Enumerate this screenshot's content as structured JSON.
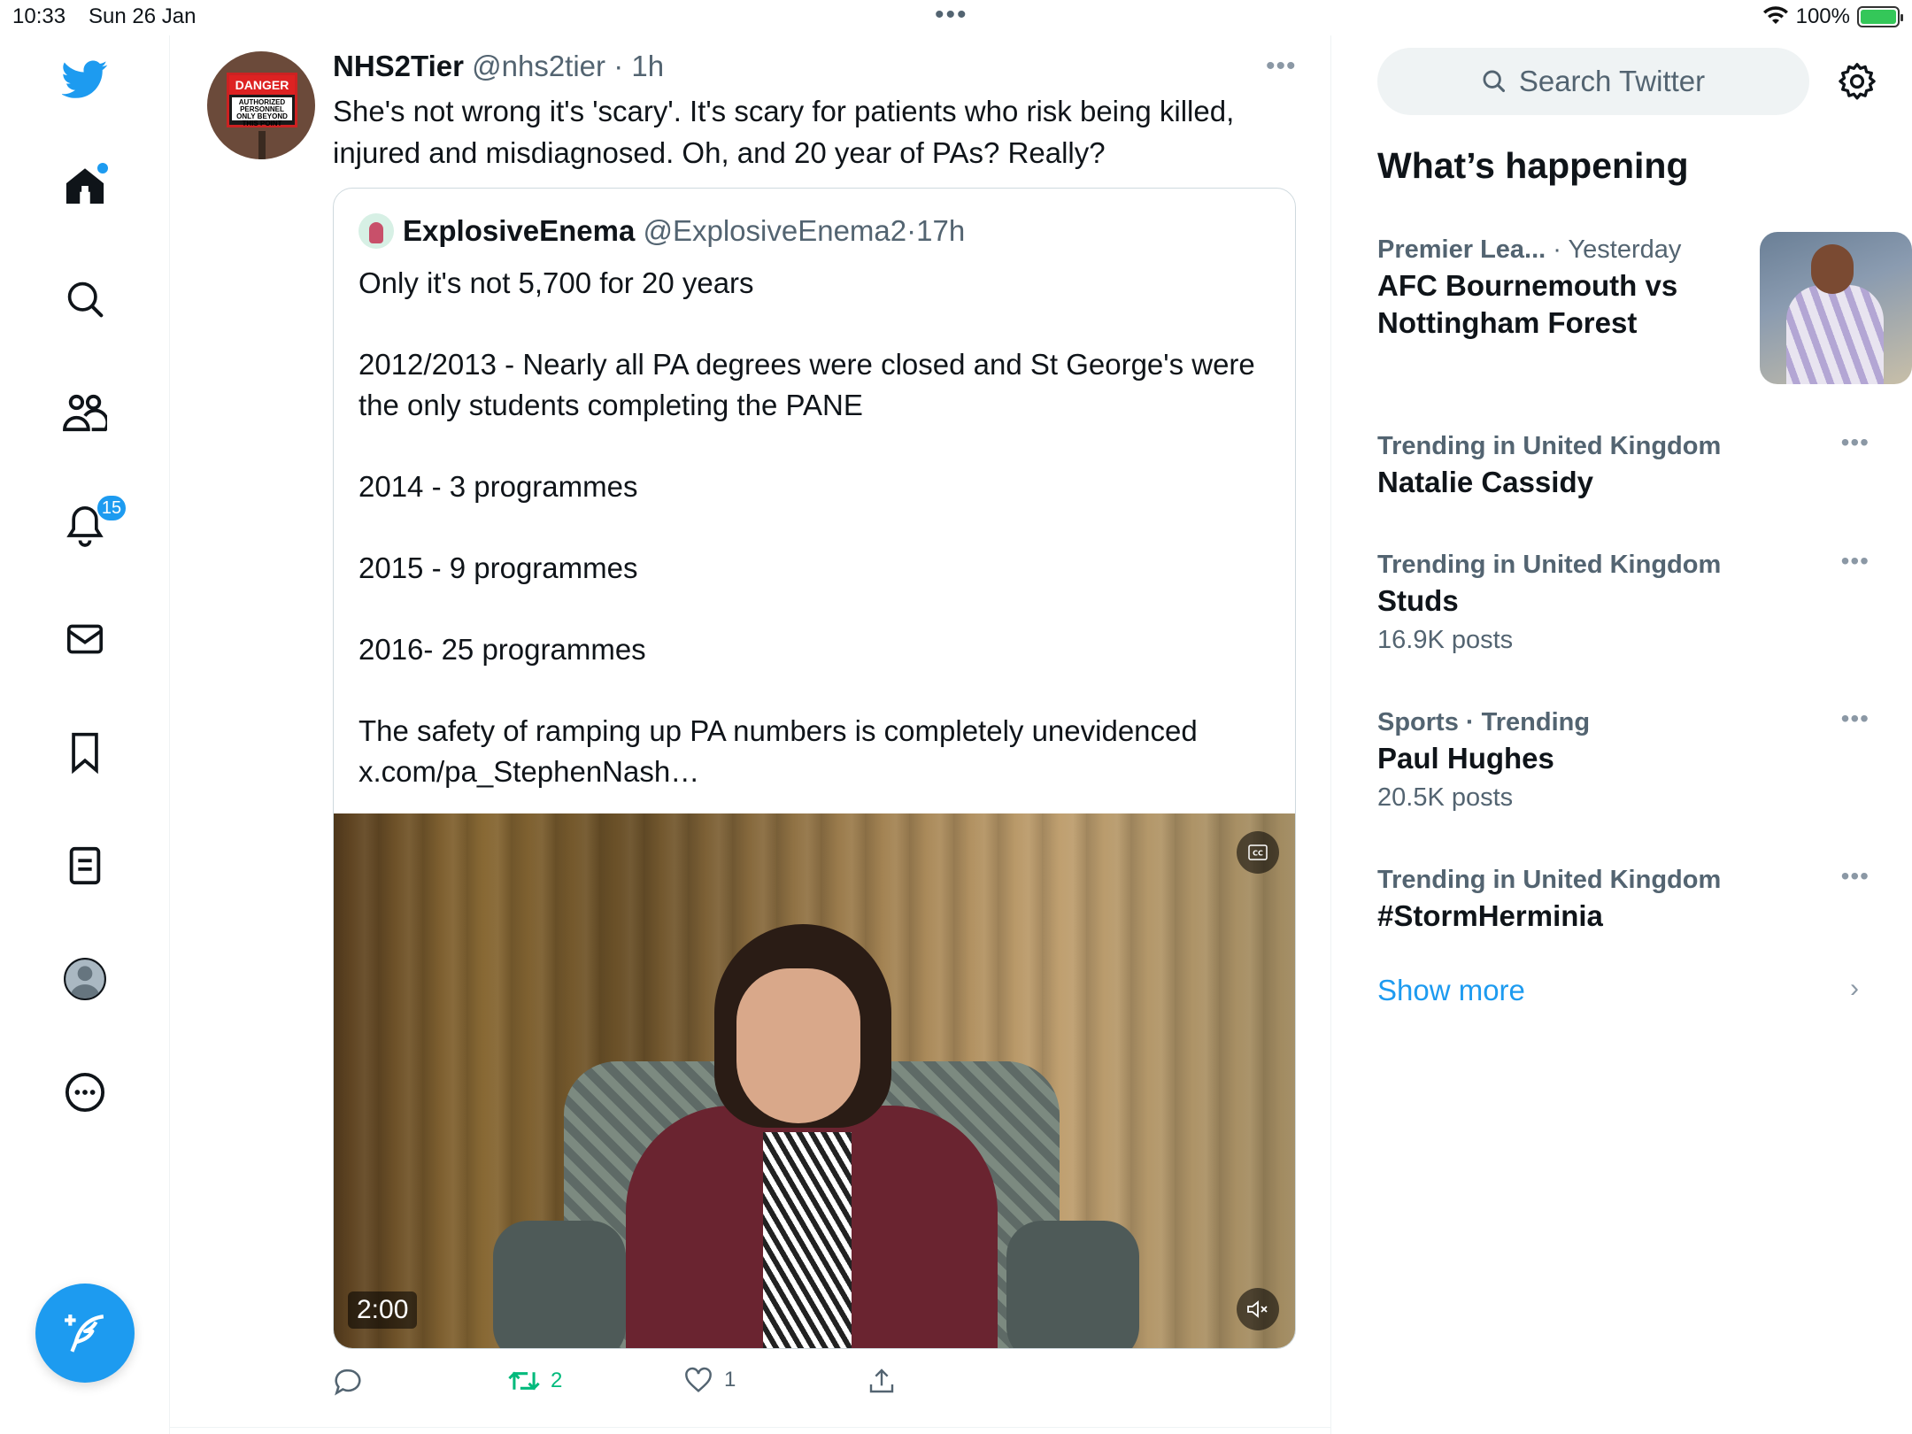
{
  "status_bar": {
    "time": "10:33",
    "date": "Sun 26 Jan",
    "battery": "100%"
  },
  "nav": {
    "notifications_badge": "15",
    "items": [
      "home-icon",
      "search-icon",
      "communities-icon",
      "notifications-icon",
      "messages-icon",
      "bookmarks-icon",
      "lists-icon",
      "profile-icon",
      "more-icon"
    ],
    "compose": "compose-icon"
  },
  "tweet": {
    "author_name": "NHS2Tier",
    "author_handle": "@nhs2tier",
    "time": "1h",
    "text": "She's not wrong it's 'scary'. It's scary for patients who risk being killed, injured and misdiagnosed. Oh, and 20 year of PAs? Really?",
    "avatar_sign_line1": "DANGER",
    "avatar_sign_line2": "AUTHORIZED PERSONNEL ONLY BEYOND THIS POINT",
    "quote": {
      "author_name": "ExplosiveEnema",
      "author_handle": "@ExplosiveEnema2",
      "time": "17h",
      "paragraphs": [
        "Only it's not 5,700 for 20 years",
        "2012/2013 - Nearly all PA degrees were closed and St George's were the only students completing the PANE",
        "2014 - 3 programmes",
        "2015 - 9 programmes",
        "2016- 25 programmes",
        "The safety of ramping up PA numbers is completely unevidenced"
      ],
      "link": "x.com/pa_StephenNash…",
      "video_duration": "2:00"
    },
    "actions": {
      "replies": "",
      "retweets": "2",
      "likes": "1"
    }
  },
  "sidebar": {
    "search_placeholder": "Search Twitter",
    "whats_happening": "What’s happening",
    "trends": [
      {
        "meta": "Premier Lea...",
        "meta_suffix": " · Yesterday",
        "name": "AFC Bournemouth vs Nottingham Forest",
        "count": ""
      },
      {
        "meta": "Trending in United Kingdom",
        "meta_suffix": "",
        "name": "Natalie Cassidy",
        "count": ""
      },
      {
        "meta": "Trending in United Kingdom",
        "meta_suffix": "",
        "name": "Studs",
        "count": "16.9K posts"
      },
      {
        "meta": "Sports · Trending",
        "meta_suffix": "",
        "name": "Paul Hughes",
        "count": "20.5K posts"
      },
      {
        "meta": "Trending in United Kingdom",
        "meta_suffix": "",
        "name": "#StormHerminia",
        "count": ""
      }
    ],
    "show_more": "Show more"
  },
  "colors": {
    "accent": "#1d9bf0",
    "retweet": "#00ba7c",
    "text": "#0f1419",
    "secondary": "#536471"
  }
}
